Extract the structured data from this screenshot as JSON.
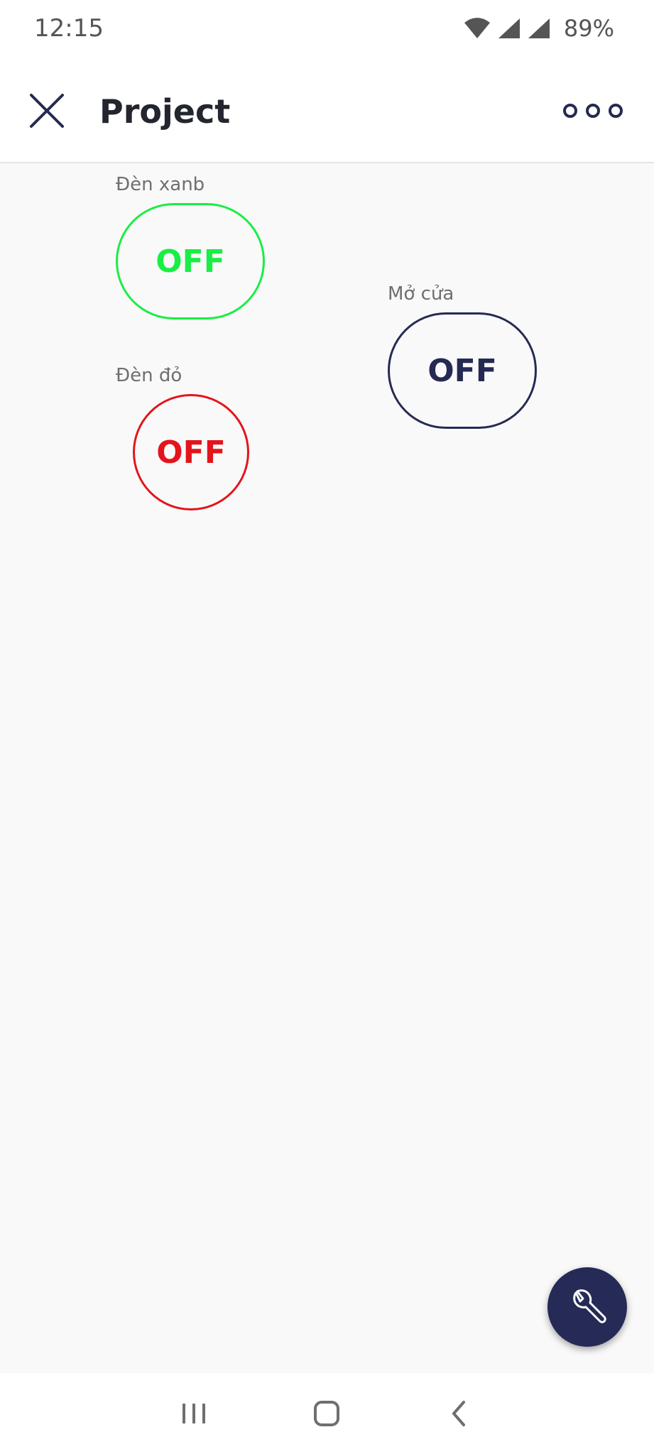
{
  "status_bar": {
    "time": "12:15",
    "battery": "89%",
    "icons": [
      "wifi-icon",
      "signal-icon",
      "signal-icon"
    ]
  },
  "app_bar": {
    "title": "Project",
    "close_icon": "close-icon",
    "more_icon": "more-horizontal-icon"
  },
  "widgets": [
    {
      "label": "Đèn xanb",
      "state": "OFF",
      "color": "#19ee44"
    },
    {
      "label": "Đèn đỏ",
      "state": "OFF",
      "color": "#e4141c"
    },
    {
      "label": "Mở cửa",
      "state": "OFF",
      "color": "#252a53"
    }
  ],
  "fab": {
    "icon": "wrench-icon",
    "color": "#252a56"
  },
  "nav_bar": {
    "items": [
      "recents-icon",
      "home-icon",
      "back-icon"
    ]
  }
}
